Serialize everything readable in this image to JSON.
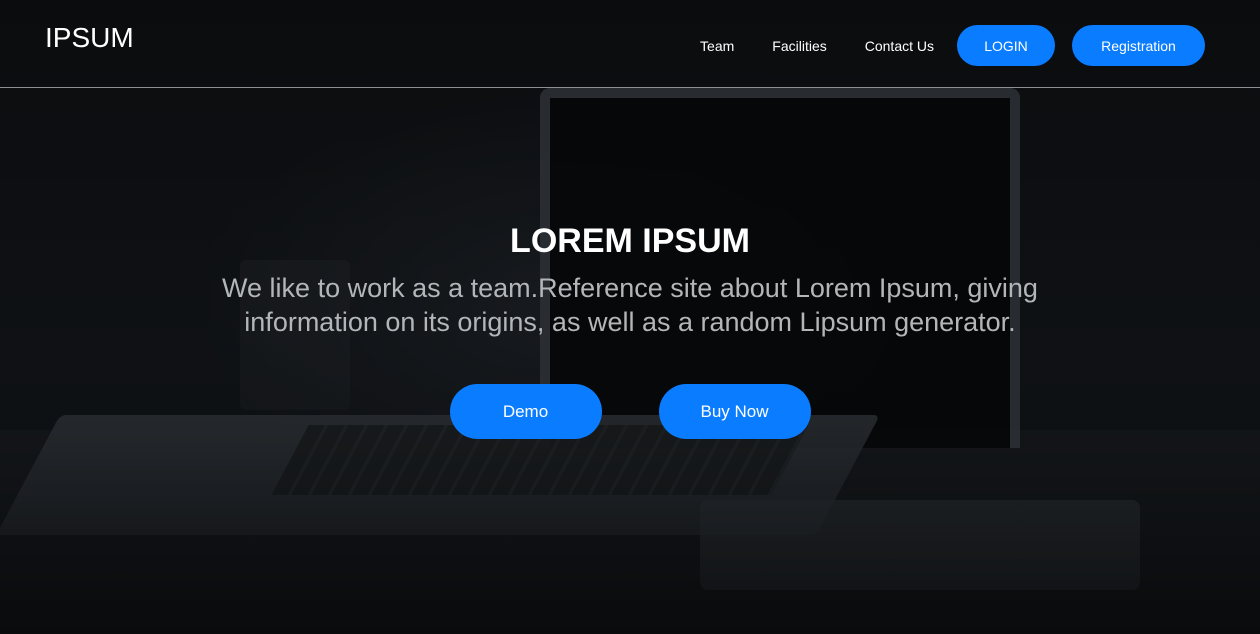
{
  "brand": "IPSUM",
  "nav": {
    "links": [
      "Team",
      "Facilities",
      "Contact Us"
    ],
    "login": "LOGIN",
    "registration": "Registration"
  },
  "hero": {
    "title": "LOREM IPSUM",
    "subtitle_line1": "We like to work as a team.Reference site about Lorem Ipsum, giving",
    "subtitle_line2": "information on its origins, as well as a random Lipsum generator.",
    "demo": "Demo",
    "buy": "Buy Now"
  },
  "colors": {
    "accent": "#0a7cff",
    "text": "#ffffff",
    "subtitle": "#b3b6b9"
  }
}
